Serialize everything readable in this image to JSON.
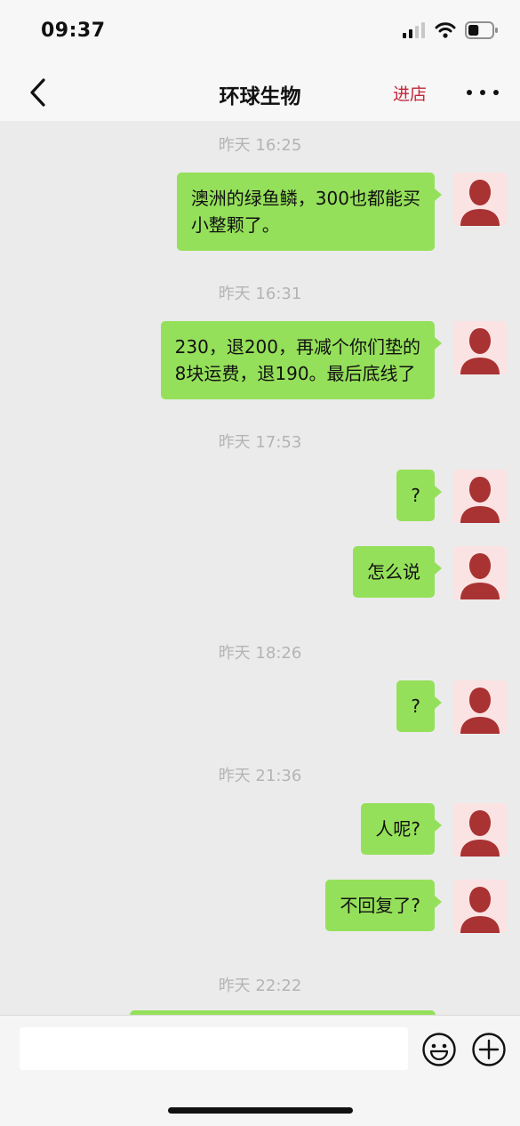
{
  "status_bar": {
    "time": "09:37",
    "battery_level": 0.45
  },
  "nav": {
    "title": "环球生物",
    "store_button": "进店"
  },
  "chat": {
    "items": [
      {
        "type": "timestamp",
        "text": "昨天 16:25"
      },
      {
        "type": "message",
        "lines": [
          "澳洲的绿鱼鳞，300也都能买",
          "小整颗了。"
        ]
      },
      {
        "type": "timestamp",
        "text": "昨天 16:31"
      },
      {
        "type": "message",
        "lines": [
          "230，退200，再减个你们垫的",
          "8块运费，退190。最后底线了"
        ]
      },
      {
        "type": "timestamp",
        "text": "昨天 17:53"
      },
      {
        "type": "message",
        "lines": [
          "?"
        ]
      },
      {
        "type": "message",
        "lines": [
          "怎么说"
        ]
      },
      {
        "type": "timestamp",
        "text": "昨天 18:26"
      },
      {
        "type": "message",
        "lines": [
          "?"
        ]
      },
      {
        "type": "timestamp",
        "text": "昨天 21:36"
      },
      {
        "type": "message",
        "lines": [
          "人呢?"
        ]
      },
      {
        "type": "message",
        "lines": [
          "不回复了?"
        ]
      },
      {
        "type": "timestamp",
        "text": "昨天 22:22"
      }
    ]
  },
  "input": {
    "placeholder": ""
  },
  "colors": {
    "bubble": "#95e05a",
    "accent": "#c2263a",
    "avatar_figure": "#a93232",
    "avatar_bg": "#fbe3e3"
  },
  "icons": [
    "chevron-left-icon",
    "more-icon",
    "signal-icon",
    "wifi-icon",
    "battery-icon",
    "avatar-person-icon",
    "emoji-icon",
    "plus-icon"
  ]
}
